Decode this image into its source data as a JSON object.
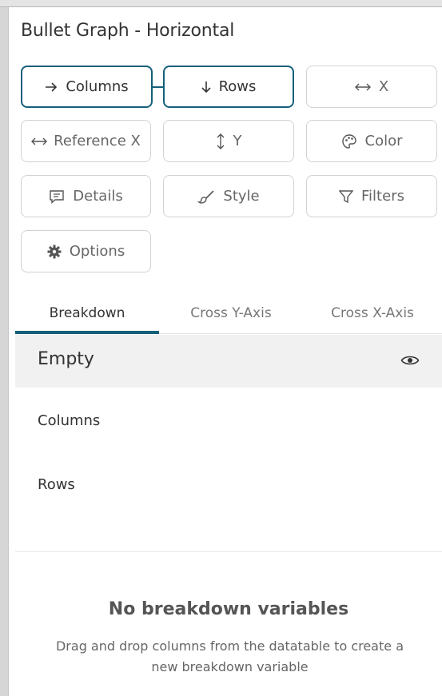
{
  "panel": {
    "title": "Bullet Graph - Horizontal"
  },
  "buttons": {
    "columns": {
      "label": "Columns",
      "icon": "arrow-right-icon"
    },
    "rows": {
      "label": "Rows",
      "icon": "arrow-down-icon"
    },
    "x": {
      "label": "X",
      "icon": "arrow-left-right-icon"
    },
    "reference_x": {
      "label": "Reference X",
      "icon": "arrow-left-right-icon"
    },
    "y": {
      "label": "Y",
      "icon": "arrow-up-down-icon"
    },
    "color": {
      "label": "Color",
      "icon": "palette-icon"
    },
    "details": {
      "label": "Details",
      "icon": "message-icon"
    },
    "style": {
      "label": "Style",
      "icon": "brush-icon"
    },
    "filters": {
      "label": "Filters",
      "icon": "filter-icon"
    },
    "options": {
      "label": "Options",
      "icon": "gear-icon"
    }
  },
  "tabs": [
    {
      "label": "Breakdown",
      "active": true
    },
    {
      "label": "Cross Y-Axis",
      "active": false
    },
    {
      "label": "Cross X-Axis",
      "active": false
    }
  ],
  "breakdown": {
    "empty_label": "Empty",
    "columns_label": "Columns",
    "rows_label": "Rows"
  },
  "empty_state": {
    "title": "No breakdown variables",
    "description": "Drag and drop columns from the datatable to create a new breakdown variable"
  },
  "colors": {
    "accent": "#14607a",
    "panel_bg": "#ffffff",
    "row_bg": "#f1f1f1"
  }
}
